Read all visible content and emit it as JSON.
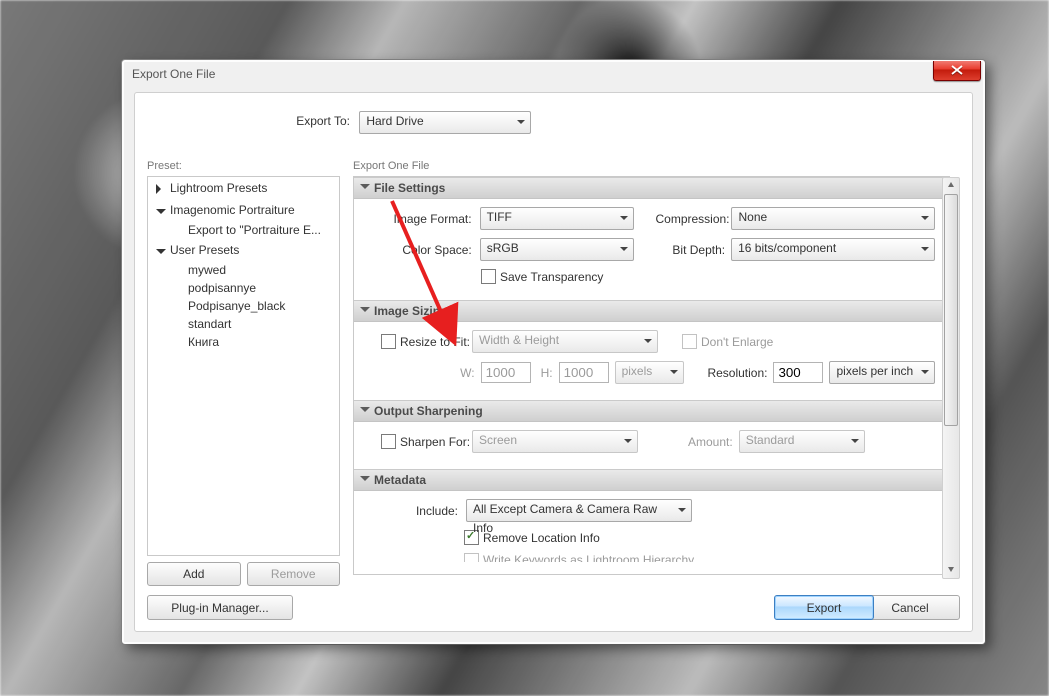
{
  "window": {
    "title": "Export One File"
  },
  "exportTo": {
    "label": "Export To:",
    "value": "Hard Drive"
  },
  "preset": {
    "label": "Preset:",
    "tree": [
      {
        "label": "Lightroom Presets",
        "expanded": false
      },
      {
        "label": "Imagenomic Portraiture",
        "expanded": true,
        "children": [
          "Export to \"Portraiture E..."
        ]
      },
      {
        "label": "User Presets",
        "expanded": true,
        "children": [
          "mywed",
          "podpisannye",
          "Podpisanye_black",
          "standart",
          "Книга"
        ]
      }
    ],
    "addLabel": "Add",
    "removeLabel": "Remove"
  },
  "main": {
    "title": "Export One File",
    "sections": {
      "fileSettings": {
        "title": "File Settings",
        "imageFormat": {
          "label": "Image Format:",
          "value": "TIFF"
        },
        "compression": {
          "label": "Compression:",
          "value": "None"
        },
        "colorSpace": {
          "label": "Color Space:",
          "value": "sRGB"
        },
        "bitDepth": {
          "label": "Bit Depth:",
          "value": "16 bits/component"
        },
        "saveTransparency": {
          "label": "Save Transparency",
          "checked": false
        }
      },
      "imageSizing": {
        "title": "Image Sizing",
        "resizeToFit": {
          "label": "Resize to Fit:",
          "checked": false,
          "value": "Width & Height"
        },
        "dontEnlarge": {
          "label": "Don't Enlarge",
          "checked": false
        },
        "wLabel": "W:",
        "wValue": "1000",
        "hLabel": "H:",
        "hValue": "1000",
        "whUnits": "pixels",
        "resolution": {
          "label": "Resolution:",
          "value": "300",
          "units": "pixels per inch"
        }
      },
      "outputSharpening": {
        "title": "Output Sharpening",
        "sharpenFor": {
          "label": "Sharpen For:",
          "checked": false,
          "value": "Screen"
        },
        "amount": {
          "label": "Amount:",
          "value": "Standard"
        }
      },
      "metadata": {
        "title": "Metadata",
        "include": {
          "label": "Include:",
          "value": "All Except Camera & Camera Raw Info"
        },
        "removeLocation": {
          "label": "Remove Location Info",
          "checked": true
        },
        "writeKeywords": {
          "label": "Write Keywords as Lightroom Hierarchy",
          "checked": false
        }
      }
    }
  },
  "footer": {
    "pluginManager": "Plug-in Manager...",
    "export": "Export",
    "cancel": "Cancel"
  }
}
